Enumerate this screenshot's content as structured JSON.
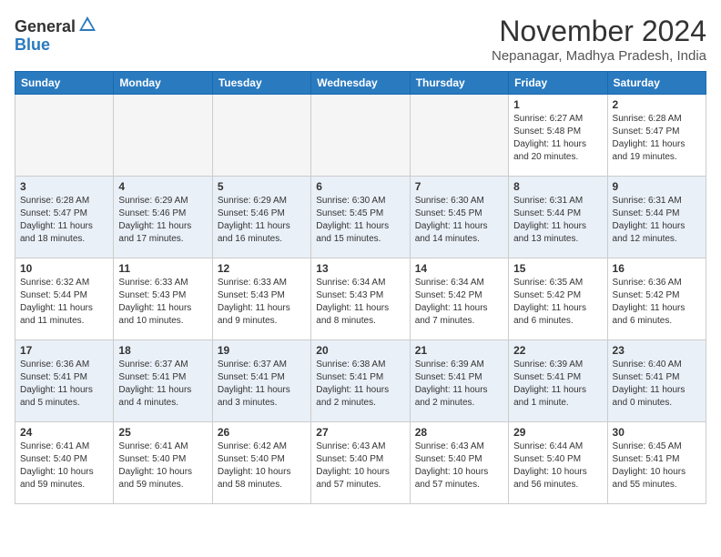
{
  "header": {
    "logo_general": "General",
    "logo_blue": "Blue",
    "month_title": "November 2024",
    "subtitle": "Nepanagar, Madhya Pradesh, India"
  },
  "weekdays": [
    "Sunday",
    "Monday",
    "Tuesday",
    "Wednesday",
    "Thursday",
    "Friday",
    "Saturday"
  ],
  "weeks": [
    [
      {
        "day": "",
        "info": ""
      },
      {
        "day": "",
        "info": ""
      },
      {
        "day": "",
        "info": ""
      },
      {
        "day": "",
        "info": ""
      },
      {
        "day": "",
        "info": ""
      },
      {
        "day": "1",
        "info": "Sunrise: 6:27 AM\nSunset: 5:48 PM\nDaylight: 11 hours\nand 20 minutes."
      },
      {
        "day": "2",
        "info": "Sunrise: 6:28 AM\nSunset: 5:47 PM\nDaylight: 11 hours\nand 19 minutes."
      }
    ],
    [
      {
        "day": "3",
        "info": "Sunrise: 6:28 AM\nSunset: 5:47 PM\nDaylight: 11 hours\nand 18 minutes."
      },
      {
        "day": "4",
        "info": "Sunrise: 6:29 AM\nSunset: 5:46 PM\nDaylight: 11 hours\nand 17 minutes."
      },
      {
        "day": "5",
        "info": "Sunrise: 6:29 AM\nSunset: 5:46 PM\nDaylight: 11 hours\nand 16 minutes."
      },
      {
        "day": "6",
        "info": "Sunrise: 6:30 AM\nSunset: 5:45 PM\nDaylight: 11 hours\nand 15 minutes."
      },
      {
        "day": "7",
        "info": "Sunrise: 6:30 AM\nSunset: 5:45 PM\nDaylight: 11 hours\nand 14 minutes."
      },
      {
        "day": "8",
        "info": "Sunrise: 6:31 AM\nSunset: 5:44 PM\nDaylight: 11 hours\nand 13 minutes."
      },
      {
        "day": "9",
        "info": "Sunrise: 6:31 AM\nSunset: 5:44 PM\nDaylight: 11 hours\nand 12 minutes."
      }
    ],
    [
      {
        "day": "10",
        "info": "Sunrise: 6:32 AM\nSunset: 5:44 PM\nDaylight: 11 hours\nand 11 minutes."
      },
      {
        "day": "11",
        "info": "Sunrise: 6:33 AM\nSunset: 5:43 PM\nDaylight: 11 hours\nand 10 minutes."
      },
      {
        "day": "12",
        "info": "Sunrise: 6:33 AM\nSunset: 5:43 PM\nDaylight: 11 hours\nand 9 minutes."
      },
      {
        "day": "13",
        "info": "Sunrise: 6:34 AM\nSunset: 5:43 PM\nDaylight: 11 hours\nand 8 minutes."
      },
      {
        "day": "14",
        "info": "Sunrise: 6:34 AM\nSunset: 5:42 PM\nDaylight: 11 hours\nand 7 minutes."
      },
      {
        "day": "15",
        "info": "Sunrise: 6:35 AM\nSunset: 5:42 PM\nDaylight: 11 hours\nand 6 minutes."
      },
      {
        "day": "16",
        "info": "Sunrise: 6:36 AM\nSunset: 5:42 PM\nDaylight: 11 hours\nand 6 minutes."
      }
    ],
    [
      {
        "day": "17",
        "info": "Sunrise: 6:36 AM\nSunset: 5:41 PM\nDaylight: 11 hours\nand 5 minutes."
      },
      {
        "day": "18",
        "info": "Sunrise: 6:37 AM\nSunset: 5:41 PM\nDaylight: 11 hours\nand 4 minutes."
      },
      {
        "day": "19",
        "info": "Sunrise: 6:37 AM\nSunset: 5:41 PM\nDaylight: 11 hours\nand 3 minutes."
      },
      {
        "day": "20",
        "info": "Sunrise: 6:38 AM\nSunset: 5:41 PM\nDaylight: 11 hours\nand 2 minutes."
      },
      {
        "day": "21",
        "info": "Sunrise: 6:39 AM\nSunset: 5:41 PM\nDaylight: 11 hours\nand 2 minutes."
      },
      {
        "day": "22",
        "info": "Sunrise: 6:39 AM\nSunset: 5:41 PM\nDaylight: 11 hours\nand 1 minute."
      },
      {
        "day": "23",
        "info": "Sunrise: 6:40 AM\nSunset: 5:41 PM\nDaylight: 11 hours\nand 0 minutes."
      }
    ],
    [
      {
        "day": "24",
        "info": "Sunrise: 6:41 AM\nSunset: 5:40 PM\nDaylight: 10 hours\nand 59 minutes."
      },
      {
        "day": "25",
        "info": "Sunrise: 6:41 AM\nSunset: 5:40 PM\nDaylight: 10 hours\nand 59 minutes."
      },
      {
        "day": "26",
        "info": "Sunrise: 6:42 AM\nSunset: 5:40 PM\nDaylight: 10 hours\nand 58 minutes."
      },
      {
        "day": "27",
        "info": "Sunrise: 6:43 AM\nSunset: 5:40 PM\nDaylight: 10 hours\nand 57 minutes."
      },
      {
        "day": "28",
        "info": "Sunrise: 6:43 AM\nSunset: 5:40 PM\nDaylight: 10 hours\nand 57 minutes."
      },
      {
        "day": "29",
        "info": "Sunrise: 6:44 AM\nSunset: 5:40 PM\nDaylight: 10 hours\nand 56 minutes."
      },
      {
        "day": "30",
        "info": "Sunrise: 6:45 AM\nSunset: 5:41 PM\nDaylight: 10 hours\nand 55 minutes."
      }
    ]
  ]
}
